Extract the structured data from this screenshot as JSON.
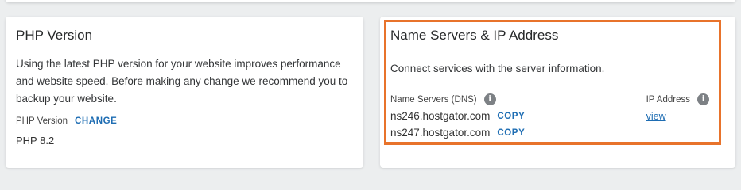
{
  "php_card": {
    "title": "PHP Version",
    "description": "Using the latest PHP version for your website improves performance and website speed. Before making any change we recommend you to backup your website.",
    "version_label": "PHP Version",
    "change_label": "CHANGE",
    "version_value": "PHP 8.2"
  },
  "ns_card": {
    "title": "Name Servers & IP Address",
    "description": "Connect services with the server information.",
    "ns_label": "Name Servers (DNS)",
    "ns_info_icon": "i",
    "servers": [
      {
        "name": "ns246.hostgator.com",
        "copy_label": "COPY"
      },
      {
        "name": "ns247.hostgator.com",
        "copy_label": "COPY"
      }
    ],
    "ip_label": "IP Address",
    "ip_info_icon": "i",
    "ip_link": "view"
  },
  "colors": {
    "accent": "#1e6db3",
    "highlight": "#e8732b",
    "info_icon_bg": "#7d8185"
  }
}
